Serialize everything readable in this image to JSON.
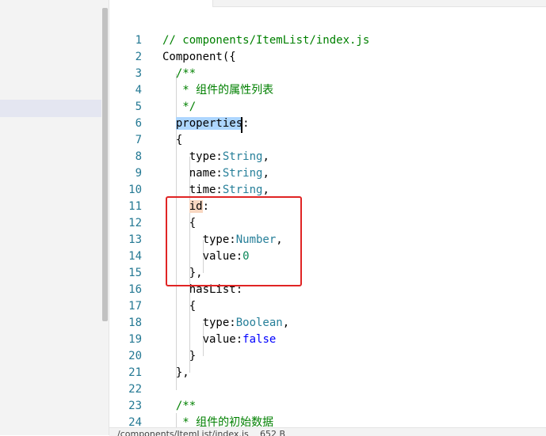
{
  "editor": {
    "lines": [
      {
        "n": "1",
        "parts": [
          [
            "comment",
            "// components/ItemList/index.js"
          ]
        ]
      },
      {
        "n": "2",
        "parts": [
          [
            "plain",
            "Component({"
          ]
        ]
      },
      {
        "n": "3",
        "parts": [
          [
            "plain",
            "  "
          ],
          [
            "comment",
            "/**"
          ]
        ]
      },
      {
        "n": "4",
        "parts": [
          [
            "plain",
            "   "
          ],
          [
            "comment",
            "* 组件的属性列表"
          ]
        ]
      },
      {
        "n": "5",
        "parts": [
          [
            "plain",
            "   "
          ],
          [
            "comment",
            "*/"
          ]
        ]
      },
      {
        "n": "6",
        "parts": [
          [
            "plain",
            "  "
          ],
          [
            "sel",
            "properties"
          ],
          [
            "plain",
            ":"
          ]
        ]
      },
      {
        "n": "7",
        "parts": [
          [
            "plain",
            "  {"
          ]
        ]
      },
      {
        "n": "8",
        "parts": [
          [
            "plain",
            "    type:"
          ],
          [
            "type",
            "String"
          ],
          [
            "plain",
            ","
          ]
        ]
      },
      {
        "n": "9",
        "parts": [
          [
            "plain",
            "    name:"
          ],
          [
            "type",
            "String"
          ],
          [
            "plain",
            ","
          ]
        ]
      },
      {
        "n": "10",
        "parts": [
          [
            "plain",
            "    time:"
          ],
          [
            "type",
            "String"
          ],
          [
            "plain",
            ","
          ]
        ]
      },
      {
        "n": "11",
        "parts": [
          [
            "plain",
            "    "
          ],
          [
            "key",
            "id"
          ],
          [
            "plain",
            ":"
          ]
        ]
      },
      {
        "n": "12",
        "parts": [
          [
            "plain",
            "    {"
          ]
        ]
      },
      {
        "n": "13",
        "parts": [
          [
            "plain",
            "      type:"
          ],
          [
            "type",
            "Number"
          ],
          [
            "plain",
            ","
          ]
        ]
      },
      {
        "n": "14",
        "parts": [
          [
            "plain",
            "      value:"
          ],
          [
            "num",
            "0"
          ]
        ]
      },
      {
        "n": "15",
        "parts": [
          [
            "plain",
            "    },"
          ]
        ]
      },
      {
        "n": "16",
        "parts": [
          [
            "plain",
            "    hasList:"
          ]
        ]
      },
      {
        "n": "17",
        "parts": [
          [
            "plain",
            "    {"
          ]
        ]
      },
      {
        "n": "18",
        "parts": [
          [
            "plain",
            "      type:"
          ],
          [
            "type",
            "Boolean"
          ],
          [
            "plain",
            ","
          ]
        ]
      },
      {
        "n": "19",
        "parts": [
          [
            "plain",
            "      value:"
          ],
          [
            "kw",
            "false"
          ]
        ]
      },
      {
        "n": "20",
        "parts": [
          [
            "plain",
            "    }"
          ]
        ]
      },
      {
        "n": "21",
        "parts": [
          [
            "plain",
            "  },"
          ]
        ]
      },
      {
        "n": "22",
        "parts": [
          [
            "plain",
            ""
          ]
        ]
      },
      {
        "n": "23",
        "parts": [
          [
            "plain",
            "  "
          ],
          [
            "comment",
            "/**"
          ]
        ]
      },
      {
        "n": "24",
        "parts": [
          [
            "plain",
            "   "
          ],
          [
            "comment",
            "* 组件的初始数据"
          ]
        ]
      }
    ]
  },
  "statusbar": {
    "path": "/components/ItemList/index.js",
    "size": "652 B"
  },
  "colors": {
    "comment": "#008000",
    "type": "#267f99",
    "keyword": "#0000ff",
    "number": "#098658",
    "line_number": "#237893",
    "selection": "#add6ff",
    "annotation_box": "#e02424"
  }
}
